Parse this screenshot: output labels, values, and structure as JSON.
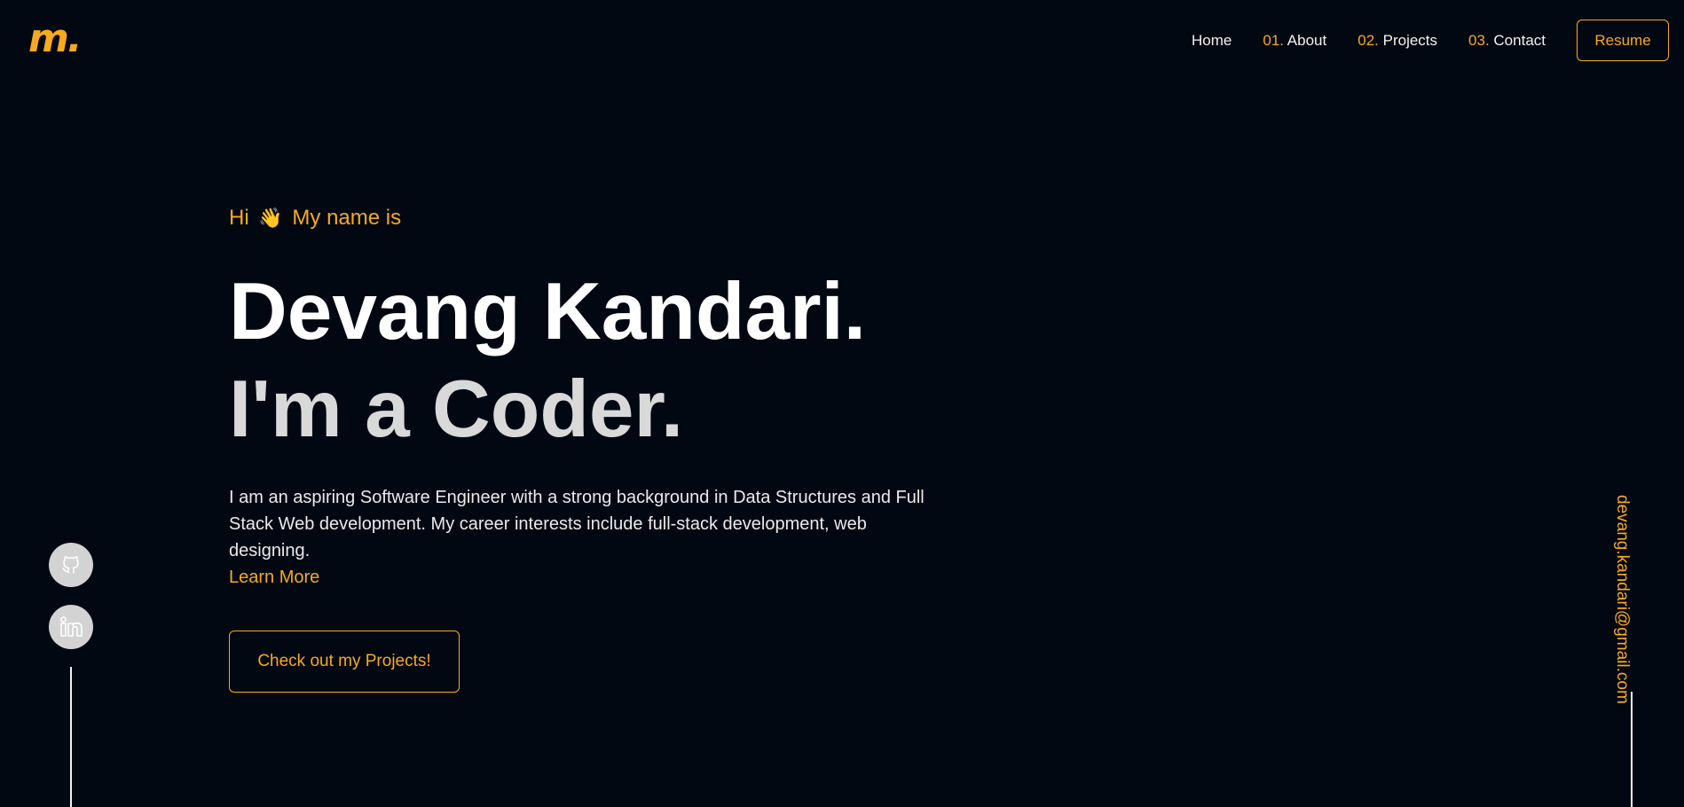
{
  "brand": {
    "logo_text": "m.",
    "accent_color": "#f7a91f",
    "background_color": "#020812"
  },
  "nav": {
    "home": "Home",
    "about_num": "01.",
    "about": "About",
    "projects_num": "02.",
    "projects": "Projects",
    "contact_num": "03.",
    "contact": "Contact",
    "resume": "Resume"
  },
  "hero": {
    "greeting_prefix": "Hi",
    "greeting_emoji": "👋",
    "greeting_suffix": "My name is",
    "name": "Devang Kandari.",
    "tagline": "I'm a Coder.",
    "bio": "I am an aspiring Software Engineer with a strong background in Data Structures and Full Stack Web development. My career interests include full-stack development, web designing.",
    "learn_more": "Learn More",
    "cta": "Check out my Projects!"
  },
  "social": {
    "icons": [
      "github-icon",
      "linkedin-icon"
    ]
  },
  "contact": {
    "email": "devang.kandari@gmail.com"
  }
}
